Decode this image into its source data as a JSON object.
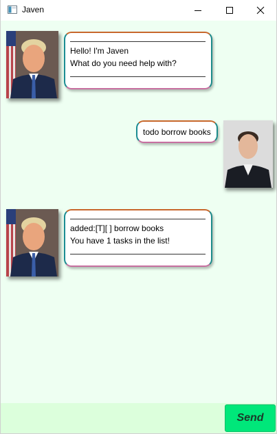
{
  "window": {
    "title": "Javen",
    "controls": {
      "minimize": "minimize-icon",
      "maximize": "maximize-icon",
      "close": "close-icon"
    }
  },
  "messages": [
    {
      "sender": "bot",
      "lines": [
        "Hello! I'm Javen",
        "What do you need help with?"
      ]
    },
    {
      "sender": "user",
      "lines": [
        "todo borrow books"
      ]
    },
    {
      "sender": "bot",
      "lines": [
        "added:[T][ ] borrow books",
        "You have 1 tasks in the list!"
      ]
    }
  ],
  "input": {
    "value": "",
    "placeholder": ""
  },
  "send_label": "Send",
  "colors": {
    "chat_background": "#eefff2",
    "input_background": "#dcffdc",
    "send_button": "#00e77a",
    "bubble_border_top": "#c8662b",
    "bubble_border_left": "#1a8c92",
    "bubble_border_bottom": "#c76fa0"
  }
}
